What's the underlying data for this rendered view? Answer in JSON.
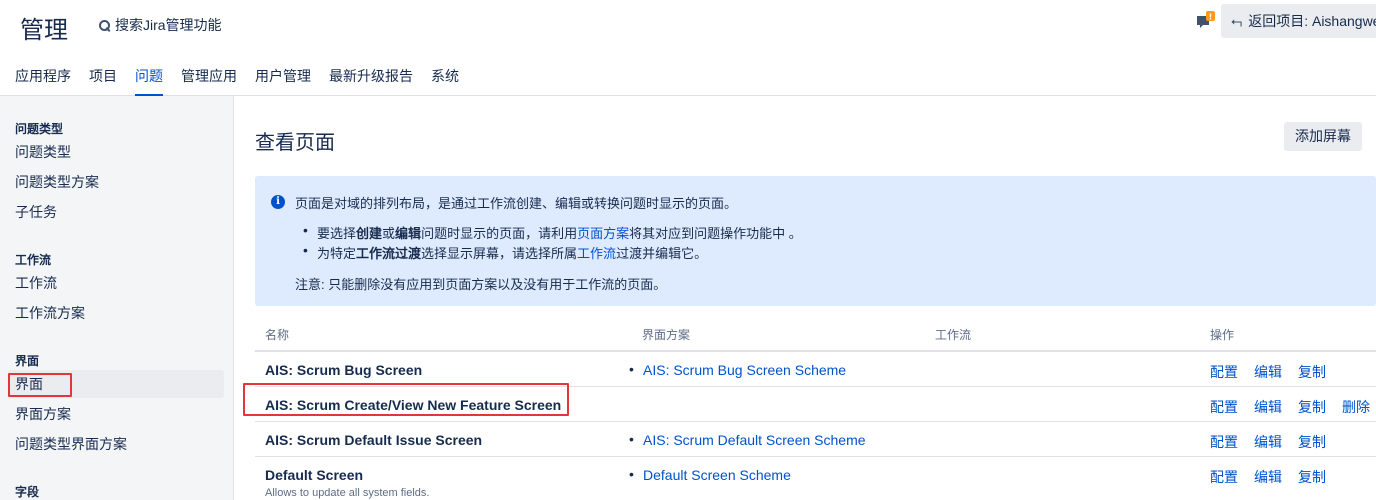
{
  "header": {
    "title": "管理",
    "search_label": "搜索Jira管理功能",
    "back_button": "返回项目: Aishangwe",
    "feedback_badge": "!"
  },
  "nav": {
    "items": [
      {
        "label": "应用程序"
      },
      {
        "label": "项目"
      },
      {
        "label": "问题",
        "active": true
      },
      {
        "label": "管理应用"
      },
      {
        "label": "用户管理"
      },
      {
        "label": "最新升级报告"
      },
      {
        "label": "系统"
      }
    ]
  },
  "sidebar": {
    "groups": [
      {
        "title": "问题类型",
        "items": [
          "问题类型",
          "问题类型方案",
          "子任务"
        ]
      },
      {
        "title": "工作流",
        "items": [
          "工作流",
          "工作流方案"
        ]
      },
      {
        "title": "界面",
        "items": [
          "界面",
          "界面方案",
          "问题类型界面方案"
        ]
      },
      {
        "title": "字段",
        "items": []
      }
    ],
    "selected": "界面"
  },
  "main": {
    "title": "查看页面",
    "add_button": "添加屏幕",
    "info": {
      "intro": "页面是对域的排列布局，是通过工作流创建、编辑或转换问题时显示的页面。",
      "bullet1": {
        "p1": "要选择",
        "b1": "创建",
        "p2": "或",
        "b2": "编辑",
        "p3": "问题时显示的页面，请利用",
        "link": "页面方案",
        "p4": "将其对应到问题操作功能中 。"
      },
      "bullet2": {
        "p1": "为特定",
        "b1": "工作流过渡",
        "p2": "选择显示屏幕，请选择所属",
        "link": "工作流",
        "p3": "过渡并编辑它。"
      },
      "note": "注意: 只能删除没有应用到页面方案以及没有用于工作流的页面。"
    },
    "table": {
      "headers": {
        "name": "名称",
        "scheme": "界面方案",
        "workflow": "工作流",
        "ops": "操作"
      },
      "rows": [
        {
          "name": "AIS: Scrum Bug Screen",
          "scheme": "AIS: Scrum Bug Screen Scheme",
          "ops": [
            "配置",
            "编辑",
            "复制"
          ]
        },
        {
          "name": "AIS: Scrum Create/View New Feature Screen",
          "scheme": "",
          "ops": [
            "配置",
            "编辑",
            "复制",
            "删除"
          ]
        },
        {
          "name": "AIS: Scrum Default Issue Screen",
          "scheme": "AIS: Scrum Default Screen Scheme",
          "ops": [
            "配置",
            "编辑",
            "复制"
          ]
        },
        {
          "name": "Default Screen",
          "subtitle": "Allows to update all system fields.",
          "scheme": "Default Screen Scheme",
          "ops": [
            "配置",
            "编辑",
            "复制"
          ]
        }
      ]
    }
  },
  "colors": {
    "link": "#0052cc",
    "info_bg": "#deebff",
    "highlight": "#e5343a",
    "sidebar_bg": "#f4f5f7"
  }
}
